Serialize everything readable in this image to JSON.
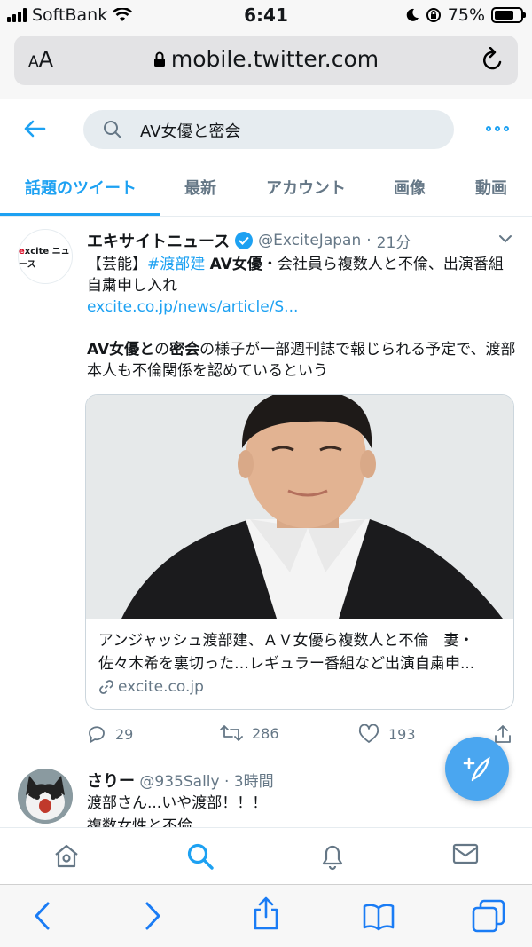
{
  "status_bar": {
    "carrier": "SoftBank",
    "time": "6:41",
    "battery_percent": "75%",
    "battery_level": 0.75
  },
  "browser": {
    "text_size_label": "AA",
    "url": "mobile.twitter.com"
  },
  "search": {
    "query": "AV女優と密会"
  },
  "tabs": [
    {
      "label": "話題のツイート",
      "active": true
    },
    {
      "label": "最新",
      "active": false
    },
    {
      "label": "アカウント",
      "active": false
    },
    {
      "label": "画像",
      "active": false
    },
    {
      "label": "動画",
      "active": false
    }
  ],
  "tweet1": {
    "avatar_text": "excite ニュース",
    "name": "エキサイトニュース",
    "handle": "@ExciteJapan",
    "time": "21分",
    "body": {
      "prefix": "【芸能】",
      "hashtag": "#渡部建",
      "bold1": "AV女優",
      "line1_rest": "・会社員ら複数人と不倫、出演番組自粛申し入れ",
      "link": "excite.co.jp/news/article/S...",
      "p2_bold_a": "AV女優と",
      "p2_text_a": "の",
      "p2_bold_b": "密会",
      "p2_text_b": "の様子が一部週刊誌で報じられる予定で、渡部本人も不倫関係を認めているという"
    },
    "card": {
      "title_line1": "アンジャッシュ渡部建、ＡＶ女優ら複数人と不倫　妻・",
      "title_line2": "佐々木希を裏切った…レギュラー番組など出演自粛申...",
      "domain": "excite.co.jp"
    },
    "reply_count": "29",
    "retweet_count": "286",
    "like_count": "193"
  },
  "tweet2": {
    "name": "さりー",
    "handle": "@935Sally",
    "time": "3時間",
    "line1": "渡部さん...いや渡部！！！",
    "line2": "複数女性と不倫"
  },
  "colors": {
    "accent": "#1da1f2",
    "secondary_text": "#657786",
    "border": "#e6ecf0"
  }
}
